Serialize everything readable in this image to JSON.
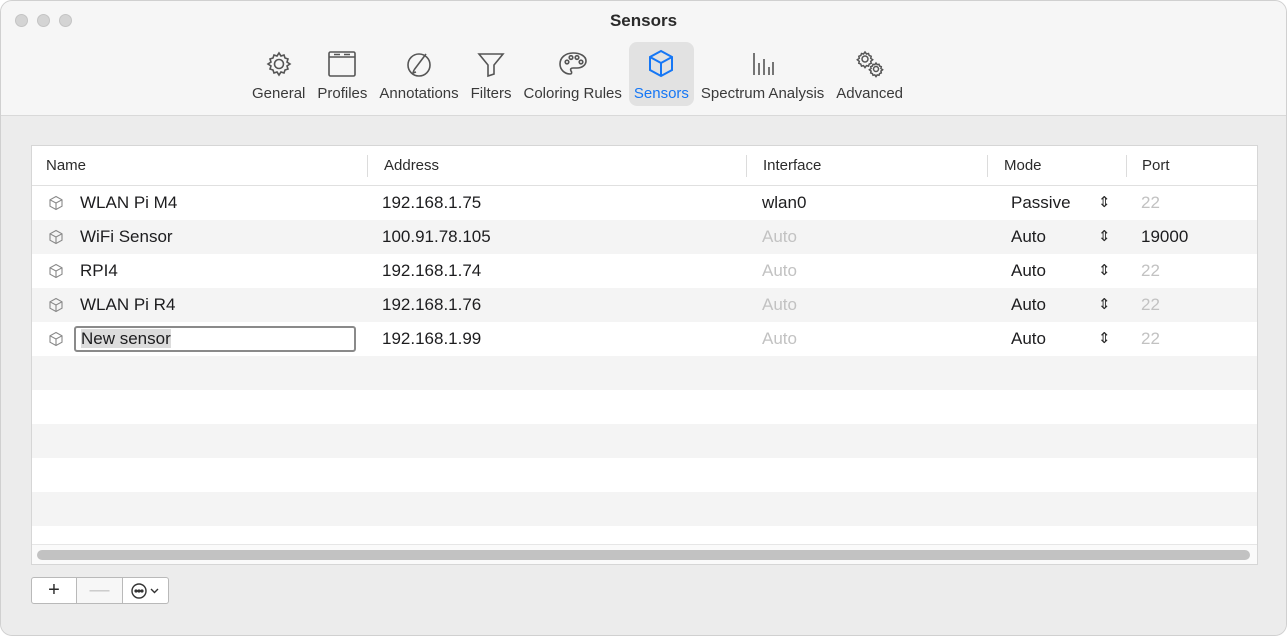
{
  "window": {
    "title": "Sensors"
  },
  "toolbar": {
    "items": [
      {
        "label": "General",
        "icon": "gear-icon",
        "active": false
      },
      {
        "label": "Profiles",
        "icon": "window-icon",
        "active": false
      },
      {
        "label": "Annotations",
        "icon": "pencil-circle-icon",
        "active": false
      },
      {
        "label": "Filters",
        "icon": "funnel-icon",
        "active": false
      },
      {
        "label": "Coloring Rules",
        "icon": "palette-icon",
        "active": false
      },
      {
        "label": "Sensors",
        "icon": "cube-icon",
        "active": true
      },
      {
        "label": "Spectrum Analysis",
        "icon": "spectrum-bars-icon",
        "active": false
      },
      {
        "label": "Advanced",
        "icon": "gears-icon",
        "active": false
      }
    ]
  },
  "accent_color": "#1677f5",
  "table": {
    "columns": [
      "Name",
      "Address",
      "Interface",
      "Mode",
      "Port"
    ],
    "rows": [
      {
        "name": "WLAN Pi M4",
        "address": "192.168.1.75",
        "interface": "wlan0",
        "interface_placeholder": false,
        "mode": "Passive",
        "port": "22",
        "port_placeholder": true,
        "editing": false
      },
      {
        "name": "WiFi Sensor",
        "address": "100.91.78.105",
        "interface": "Auto",
        "interface_placeholder": true,
        "mode": "Auto",
        "port": "19000",
        "port_placeholder": false,
        "editing": false
      },
      {
        "name": "RPI4",
        "address": "192.168.1.74",
        "interface": "Auto",
        "interface_placeholder": true,
        "mode": "Auto",
        "port": "22",
        "port_placeholder": true,
        "editing": false
      },
      {
        "name": "WLAN Pi R4",
        "address": "192.168.1.76",
        "interface": "Auto",
        "interface_placeholder": true,
        "mode": "Auto",
        "port": "22",
        "port_placeholder": true,
        "editing": false
      },
      {
        "name": "New sensor",
        "address": "192.168.1.99",
        "interface": "Auto",
        "interface_placeholder": true,
        "mode": "Auto",
        "port": "22",
        "port_placeholder": true,
        "editing": true
      }
    ]
  },
  "bottom_bar": {
    "add_label": "+",
    "remove_label": "—",
    "more_label": "⊙⌄"
  }
}
